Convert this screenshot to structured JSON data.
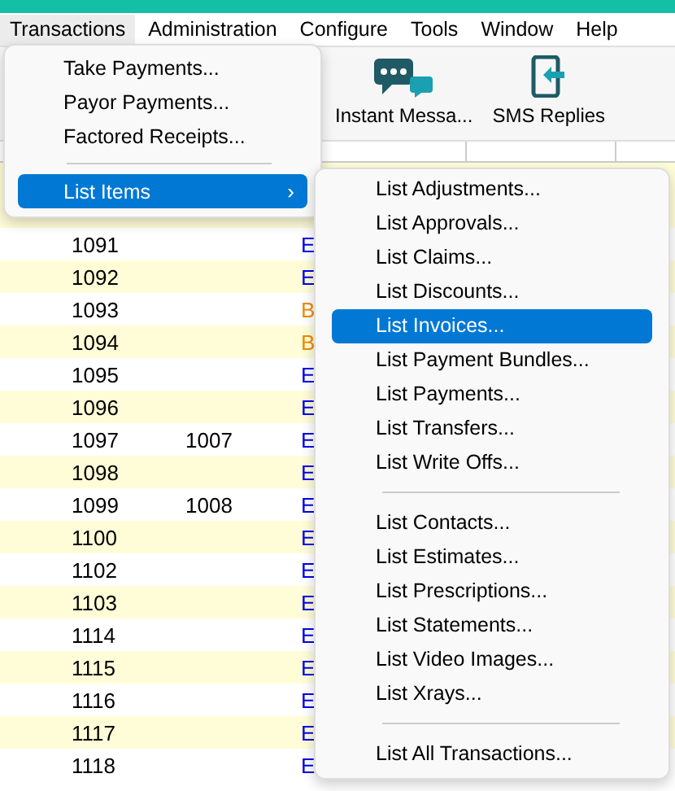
{
  "menubar": [
    {
      "label": "Transactions",
      "selected": true
    },
    {
      "label": "Administration",
      "selected": false
    },
    {
      "label": "Configure",
      "selected": false
    },
    {
      "label": "Tools",
      "selected": false
    },
    {
      "label": "Window",
      "selected": false
    },
    {
      "label": "Help",
      "selected": false
    }
  ],
  "toolbar": [
    {
      "label": "Instant Messa...",
      "kind": "chat"
    },
    {
      "label": "SMS Replies",
      "kind": "phone"
    }
  ],
  "menu": {
    "items": [
      {
        "kind": "item",
        "label": "Take Payments...",
        "selected": false
      },
      {
        "kind": "item",
        "label": "Payor Payments...",
        "selected": false
      },
      {
        "kind": "item",
        "label": "Factored Receipts...",
        "selected": false
      },
      {
        "kind": "separator"
      },
      {
        "kind": "submenu",
        "label": "List Items",
        "arrow": "›",
        "selected": true
      }
    ]
  },
  "submenu": {
    "items": [
      {
        "kind": "item",
        "label": "List Adjustments...",
        "selected": false
      },
      {
        "kind": "item",
        "label": "List Approvals...",
        "selected": false
      },
      {
        "kind": "item",
        "label": "List Claims...",
        "selected": false
      },
      {
        "kind": "item",
        "label": "List Discounts...",
        "selected": false
      },
      {
        "kind": "item",
        "label": "List Invoices...",
        "selected": true
      },
      {
        "kind": "item",
        "label": "List Payment Bundles...",
        "selected": false
      },
      {
        "kind": "item",
        "label": "List Payments...",
        "selected": false
      },
      {
        "kind": "item",
        "label": "List Transfers...",
        "selected": false
      },
      {
        "kind": "item",
        "label": "List Write Offs...",
        "selected": false
      },
      {
        "kind": "separator"
      },
      {
        "kind": "item",
        "label": "List Contacts...",
        "selected": false
      },
      {
        "kind": "item",
        "label": "List Estimates...",
        "selected": false
      },
      {
        "kind": "item",
        "label": "List Prescriptions...",
        "selected": false
      },
      {
        "kind": "item",
        "label": "List Statements...",
        "selected": false
      },
      {
        "kind": "item",
        "label": "List Video Images...",
        "selected": false
      },
      {
        "kind": "item",
        "label": "List Xrays...",
        "selected": false
      },
      {
        "kind": "separator"
      },
      {
        "kind": "item",
        "label": "List All Transactions...",
        "selected": false
      }
    ]
  },
  "table": {
    "rows": [
      {
        "column_1": "1091",
        "column_3": "E",
        "color": "#0000ee"
      },
      {
        "column_1": "1092",
        "column_3": "E",
        "color": "#0000ee"
      },
      {
        "column_1": "1093",
        "column_3": "B",
        "color": "#f08a00"
      },
      {
        "column_1": "1094",
        "column_3": "B",
        "color": "#f08a00"
      },
      {
        "column_1": "1095",
        "column_3": "E",
        "color": "#0000ee"
      },
      {
        "column_1": "1096",
        "column_3": "E",
        "color": "#0000ee"
      },
      {
        "column_1": "1097",
        "column_2": "1007",
        "column_3": "E",
        "color": "#0000ee"
      },
      {
        "column_1": "1098",
        "column_3": "E",
        "color": "#0000ee"
      },
      {
        "column_1": "1099",
        "column_2": "1008",
        "column_3": "E",
        "color": "#0000ee"
      },
      {
        "column_1": "1100",
        "column_3": "E",
        "color": "#0000ee"
      },
      {
        "column_1": "1102",
        "column_3": "E",
        "color": "#0000ee"
      },
      {
        "column_1": "1103",
        "column_3": "E",
        "color": "#0000ee"
      },
      {
        "column_1": "1114",
        "column_3": "E",
        "color": "#0000ee"
      },
      {
        "column_1": "1115",
        "column_3": "E",
        "color": "#0000ee"
      },
      {
        "column_1": "1116",
        "column_3": "E",
        "color": "#0000ee"
      },
      {
        "column_1": "1117",
        "column_3": "E",
        "color": "#0000ee"
      },
      {
        "column_1": "1118",
        "column_3": "E",
        "color": "#0000ee"
      }
    ]
  }
}
